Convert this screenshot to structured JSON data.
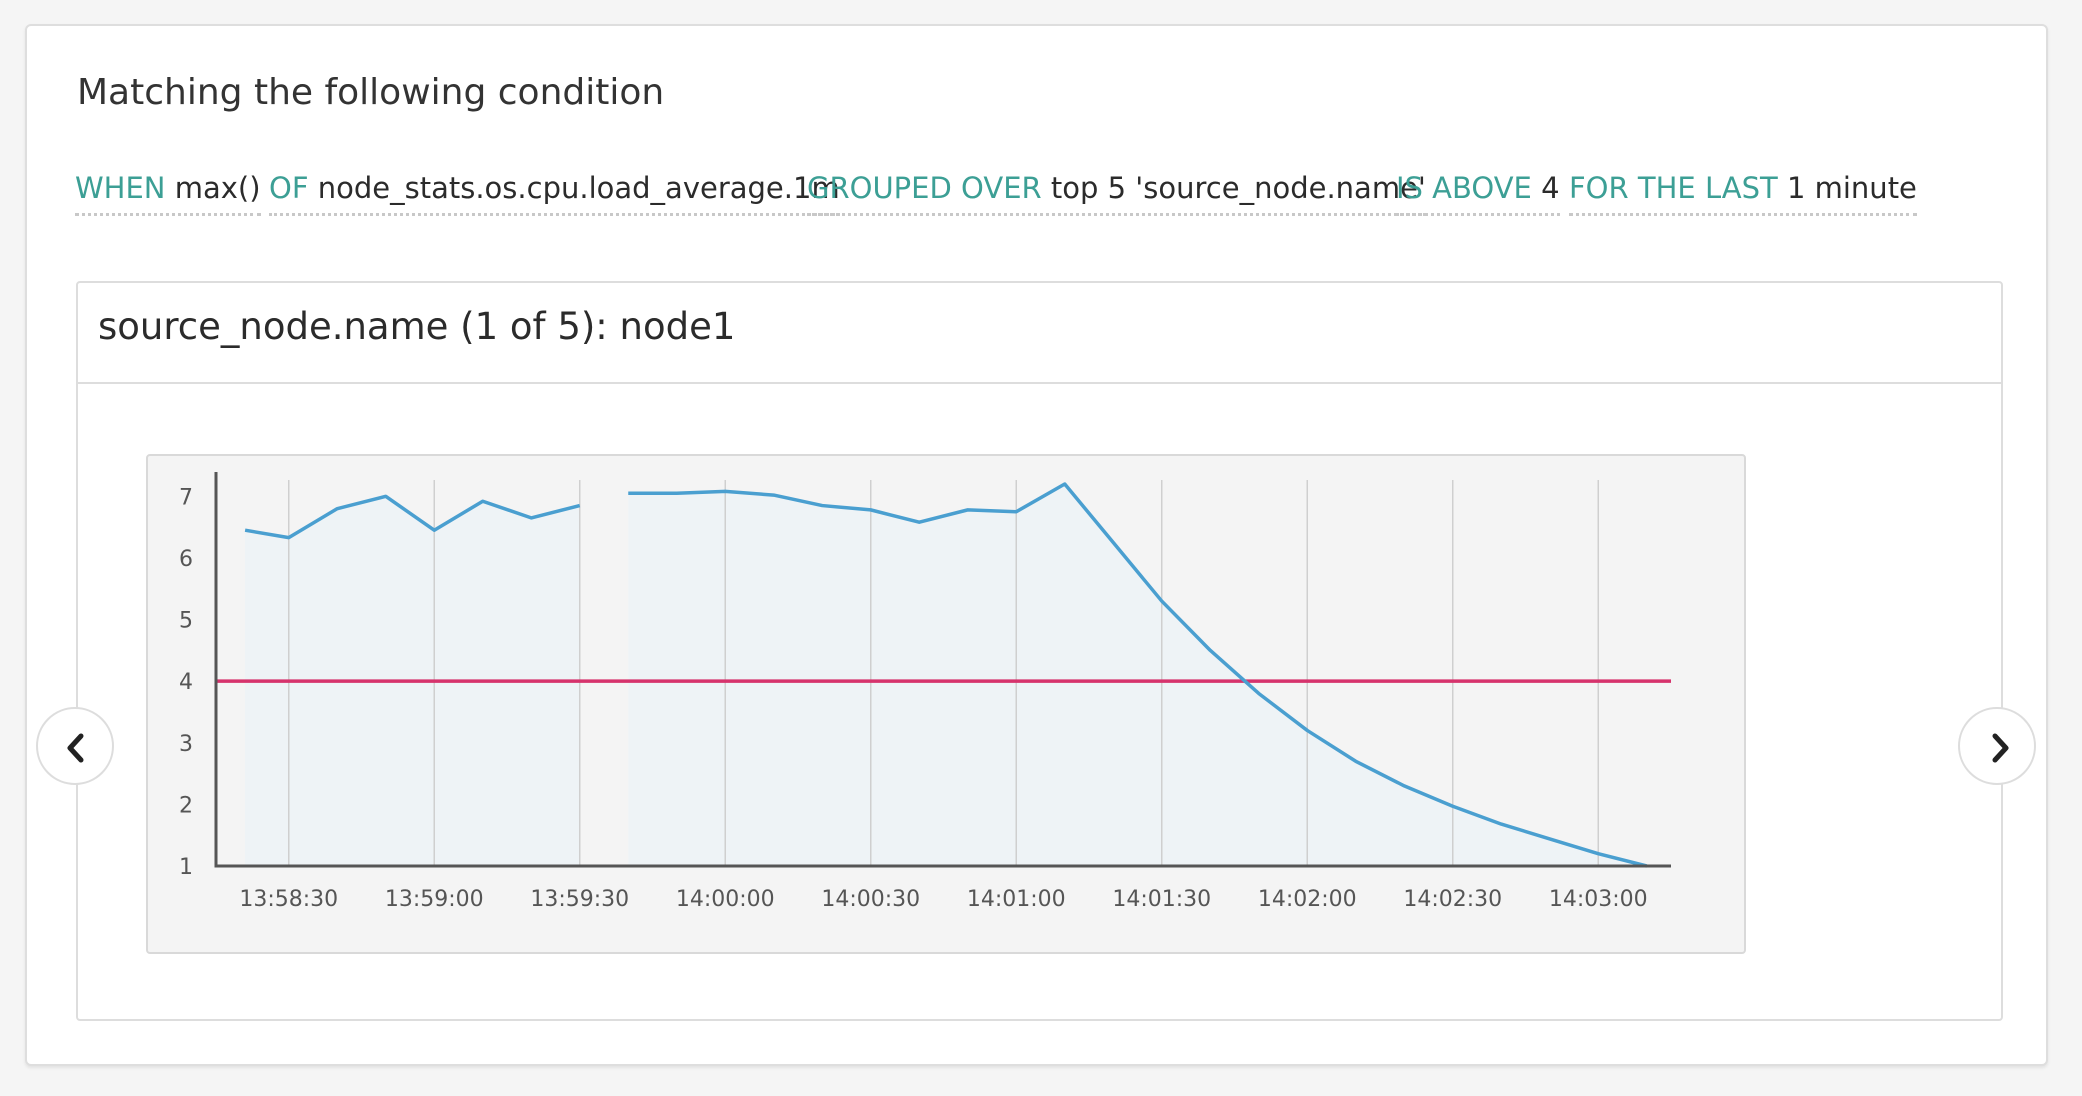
{
  "heading": "Matching the following condition",
  "expression": {
    "when": {
      "keyword": "WHEN",
      "value": "max()"
    },
    "of": {
      "keyword": "OF",
      "value": "node_stats.os.cpu.load_average.1m"
    },
    "grouped_over": {
      "keyword": "GROUPED OVER",
      "value": "top 5 'source_node.name'"
    },
    "is_above": {
      "keyword": "IS ABOVE",
      "value": "4"
    },
    "for_the_last": {
      "keyword": "FOR THE LAST",
      "value": "1 minute"
    }
  },
  "panel": {
    "title": "source_node.name (1 of 5): node1"
  },
  "colors": {
    "keyword": "#3c9f95",
    "series": "#4a9fd0",
    "threshold": "#d6336c",
    "area_fill": "#eef3f6"
  },
  "icons": {
    "prev": "chevron-left-icon",
    "next": "chevron-right-icon"
  },
  "chart_data": {
    "type": "line",
    "title": "",
    "xlabel": "",
    "ylabel": "",
    "x_time_start": "13:58:15",
    "x_time_end": "14:03:15",
    "ylim": [
      1,
      7.2
    ],
    "y_ticks": [
      "1",
      "2",
      "3",
      "4",
      "5",
      "6",
      "7"
    ],
    "x_ticks": [
      "13:58:30",
      "13:59:00",
      "13:59:30",
      "14:00:00",
      "14:00:30",
      "14:01:00",
      "14:01:30",
      "14:02:00",
      "14:02:30",
      "14:03:00"
    ],
    "threshold": 4,
    "grid": true,
    "series": [
      {
        "segments": [
          [
            [
              "13:58:21",
              6.45
            ],
            [
              "13:58:30",
              6.33
            ],
            [
              "13:58:40",
              6.8
            ],
            [
              "13:58:50",
              7.0
            ],
            [
              "13:59:00",
              6.45
            ],
            [
              "13:59:10",
              6.92
            ],
            [
              "13:59:20",
              6.65
            ],
            [
              "13:59:30",
              6.85
            ]
          ],
          [
            [
              "13:59:40",
              7.05
            ],
            [
              "13:59:50",
              7.05
            ],
            [
              "14:00:00",
              7.08
            ],
            [
              "14:00:10",
              7.02
            ],
            [
              "14:00:20",
              6.85
            ],
            [
              "14:00:30",
              6.78
            ],
            [
              "14:00:40",
              6.58
            ],
            [
              "14:00:50",
              6.78
            ],
            [
              "14:01:00",
              6.75
            ],
            [
              "14:01:10",
              7.2
            ],
            [
              "14:01:20",
              6.25
            ],
            [
              "14:01:30",
              5.3
            ],
            [
              "14:01:40",
              4.5
            ],
            [
              "14:01:50",
              3.8
            ],
            [
              "14:02:00",
              3.2
            ],
            [
              "14:02:10",
              2.7
            ],
            [
              "14:02:20",
              2.3
            ],
            [
              "14:02:30",
              1.97
            ],
            [
              "14:02:40",
              1.68
            ],
            [
              "14:02:50",
              1.44
            ],
            [
              "14:03:00",
              1.2
            ],
            [
              "14:03:10",
              1.0
            ]
          ]
        ]
      }
    ]
  }
}
